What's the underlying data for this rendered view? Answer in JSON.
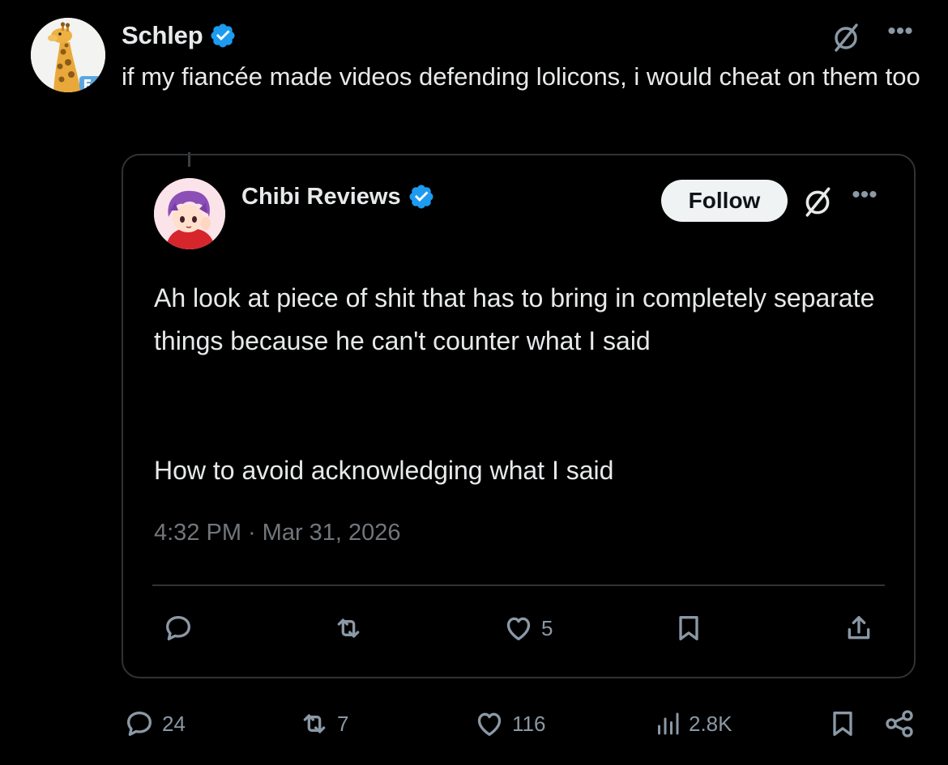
{
  "post": {
    "author": {
      "name": "Schlep",
      "verified": true,
      "avatar_icon": "giraffe-avatar-icon"
    },
    "text": "if my fiancée made videos defending lolicons, i would cheat on them too",
    "actions": {
      "replies": "24",
      "reposts": "7",
      "likes": "116",
      "views": "2.8K"
    }
  },
  "quote": {
    "author": {
      "name": "Chibi Reviews",
      "verified": true,
      "avatar_icon": "chibi-avatar-icon"
    },
    "follow_label": "Follow",
    "paragraphs": [
      "Ah look at piece of shit that has to bring in completely separate things because he can't counter what I said",
      "How to avoid acknowledging what I said"
    ],
    "time": "4:32 PM",
    "separator": "·",
    "date": "Mar 31, 2026",
    "actions": {
      "likes": "5"
    }
  },
  "colors": {
    "background": "#000000",
    "text": "#e7e9ea",
    "muted": "#71767b",
    "icon": "#8b98a5",
    "verified": "#1d9bf0",
    "border": "#2f3336"
  }
}
